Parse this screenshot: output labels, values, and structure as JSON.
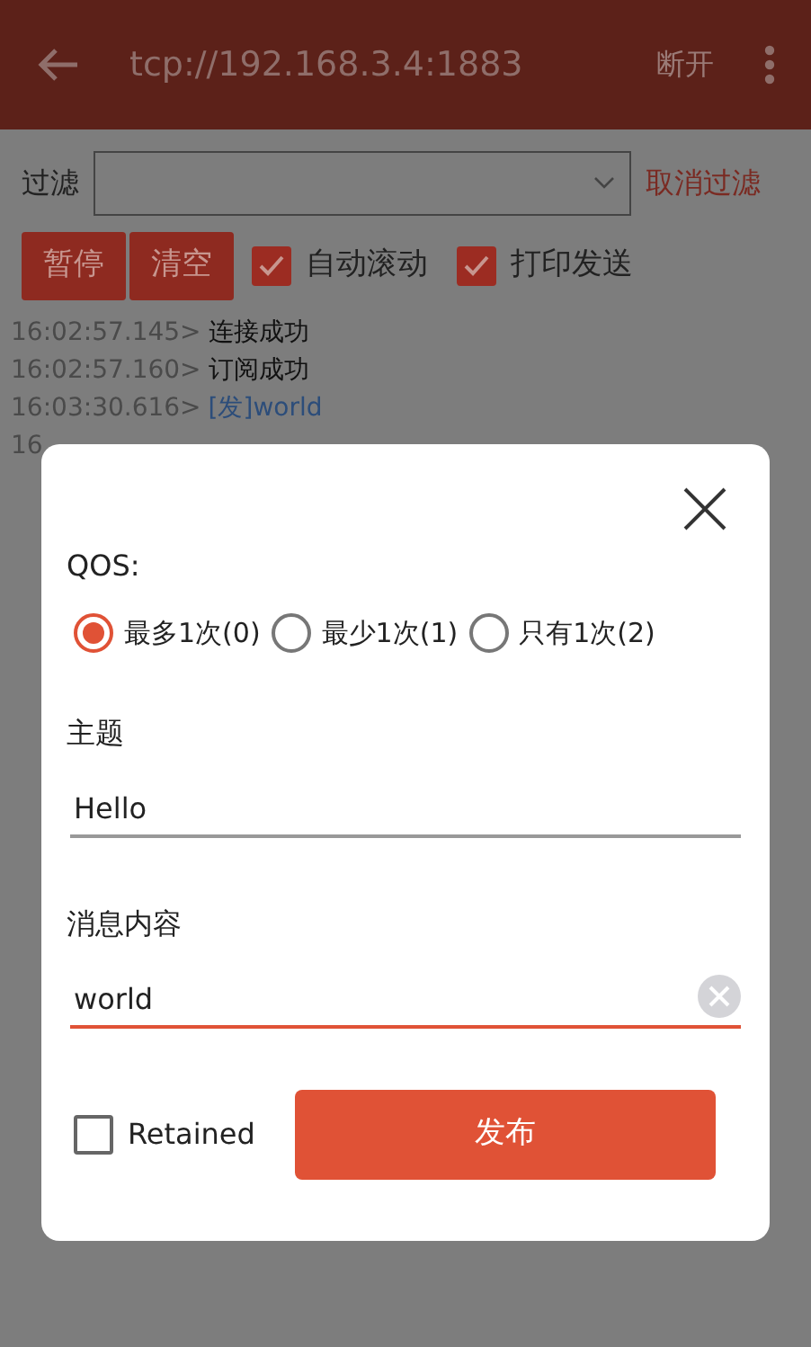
{
  "app_bar": {
    "title": "tcp://192.168.3.4:1883",
    "action": "断开"
  },
  "filter": {
    "label": "过滤",
    "cancel": "取消过滤"
  },
  "buttons": [
    "暂停",
    "清空"
  ],
  "checkboxes": [
    {
      "label": "自动滚动",
      "checked": true
    },
    {
      "label": "打印发送",
      "checked": true
    }
  ],
  "log": [
    {
      "time": "16:02:57.145>",
      "message": "连接成功",
      "kind": "status"
    },
    {
      "time": "16:02:57.160>",
      "message": "订阅成功",
      "kind": "status"
    },
    {
      "time": "16:03:30.616>",
      "message": "[发]world",
      "kind": "sent"
    },
    {
      "time": "16"
    }
  ],
  "dialog": {
    "qos_label": "QOS:",
    "qos_options": [
      {
        "label": "最多1次(0)",
        "selected": true
      },
      {
        "label": "最少1次(1)",
        "selected": false
      },
      {
        "label": "只有1次(2)",
        "selected": false
      }
    ],
    "fields": [
      {
        "label": "主题",
        "value": "Hello",
        "focused": false
      },
      {
        "label": "消息内容",
        "value": "world",
        "focused": true
      }
    ],
    "retained": {
      "label": "Retained",
      "checked": false
    },
    "publish": "发布"
  }
}
